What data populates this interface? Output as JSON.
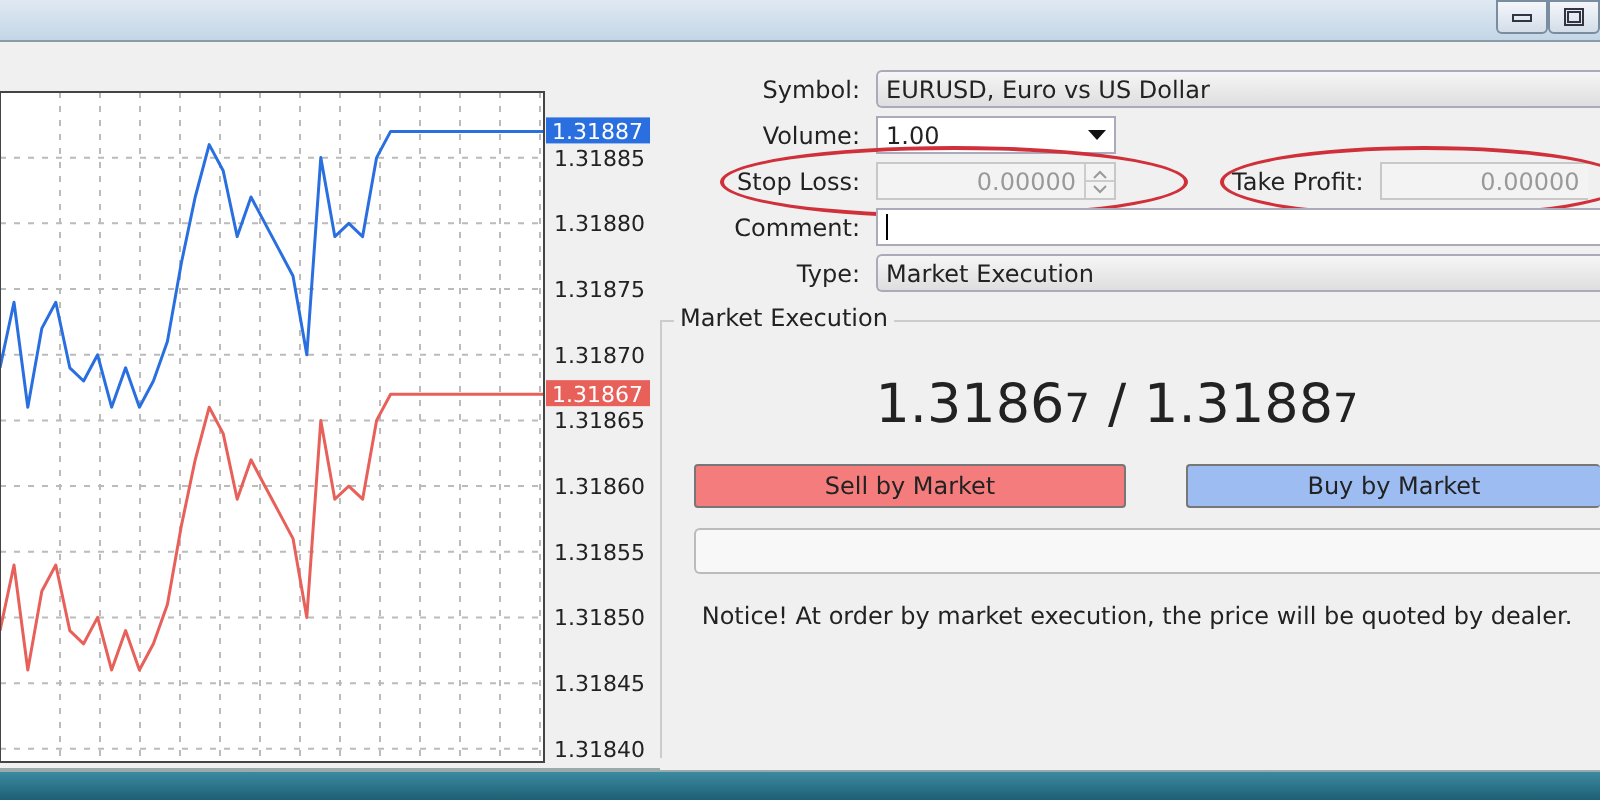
{
  "chart": {
    "chart_data": {
      "type": "line",
      "grid": true,
      "ylim": [
        1.31839,
        1.3189
      ],
      "categories": [
        null,
        null,
        null,
        null,
        null,
        null,
        null,
        null,
        null,
        null,
        null,
        null,
        null,
        null,
        null,
        null,
        null,
        null,
        null,
        null,
        null,
        null,
        null,
        null,
        null,
        null,
        null,
        null,
        null,
        null,
        null,
        null,
        null,
        null,
        null,
        null,
        null,
        null,
        null,
        null
      ],
      "series": [
        {
          "color": "#2a6fe0",
          "values": [
            1.31869,
            1.31874,
            1.31866,
            1.31872,
            1.31874,
            1.31869,
            1.31868,
            1.3187,
            1.31866,
            1.31869,
            1.31866,
            1.31868,
            1.31871,
            1.31877,
            1.31882,
            1.31886,
            1.31884,
            1.31879,
            1.31882,
            1.3188,
            1.31878,
            1.31876,
            1.3187,
            1.31885,
            1.31879,
            1.3188,
            1.31879,
            1.31885,
            1.31887,
            1.31887,
            1.31887,
            1.31887,
            1.31887,
            1.31887,
            1.31887,
            1.31887,
            1.31887,
            1.31887,
            1.31887,
            1.31887
          ]
        },
        {
          "color": "#e8605a",
          "values": [
            1.31849,
            1.31854,
            1.31846,
            1.31852,
            1.31854,
            1.31849,
            1.31848,
            1.3185,
            1.31846,
            1.31849,
            1.31846,
            1.31848,
            1.31851,
            1.31857,
            1.31862,
            1.31866,
            1.31864,
            1.31859,
            1.31862,
            1.3186,
            1.31858,
            1.31856,
            1.3185,
            1.31865,
            1.31859,
            1.3186,
            1.31859,
            1.31865,
            1.31867,
            1.31867,
            1.31867,
            1.31867,
            1.31867,
            1.31867,
            1.31867,
            1.31867,
            1.31867,
            1.31867,
            1.31867,
            1.31867
          ]
        }
      ],
      "yticks": [
        {
          "value": 1.3184,
          "label": "1.31840"
        },
        {
          "value": 1.31845,
          "label": "1.31845"
        },
        {
          "value": 1.3185,
          "label": "1.31850"
        },
        {
          "value": 1.31855,
          "label": "1.31855"
        },
        {
          "value": 1.3186,
          "label": "1.31860"
        },
        {
          "value": 1.31865,
          "label": "1.31865"
        },
        {
          "value": 1.3187,
          "label": "1.31870"
        },
        {
          "value": 1.31875,
          "label": "1.31875"
        },
        {
          "value": 1.3188,
          "label": "1.31880"
        },
        {
          "value": 1.31885,
          "label": "1.31885"
        }
      ]
    },
    "price_tags": [
      {
        "text": "1.31887"
      },
      {
        "text": "1.31867"
      }
    ]
  },
  "form": {
    "symbol": {
      "label": "Symbol:",
      "value": "EURUSD, Euro vs US Dollar"
    },
    "volume": {
      "label": "Volume:",
      "value": "1.00"
    },
    "stop_loss": {
      "label": "Stop Loss:",
      "value": "0.00000",
      "disabled": true,
      "highlighted": true
    },
    "take_profit": {
      "label": "Take Profit:",
      "value": "0.00000",
      "disabled": true,
      "highlighted": true
    },
    "comment": {
      "label": "Comment:"
    },
    "type": {
      "label": "Type:",
      "value": "Market Execution"
    }
  },
  "market_execution": {
    "title": "Market Execution",
    "quote": {
      "bid": "1.3186",
      "bid_fraction": "7",
      "separator": "/",
      "ask": "1.3188",
      "ask_fraction": "7"
    },
    "buttons": [
      {
        "label": "Sell by Market",
        "color": "#f47c7c"
      },
      {
        "label": "Buy by Market",
        "color": "#9dbcf2"
      }
    ],
    "notice": "Notice! At order by market execution, the price will be quoted by dealer."
  }
}
